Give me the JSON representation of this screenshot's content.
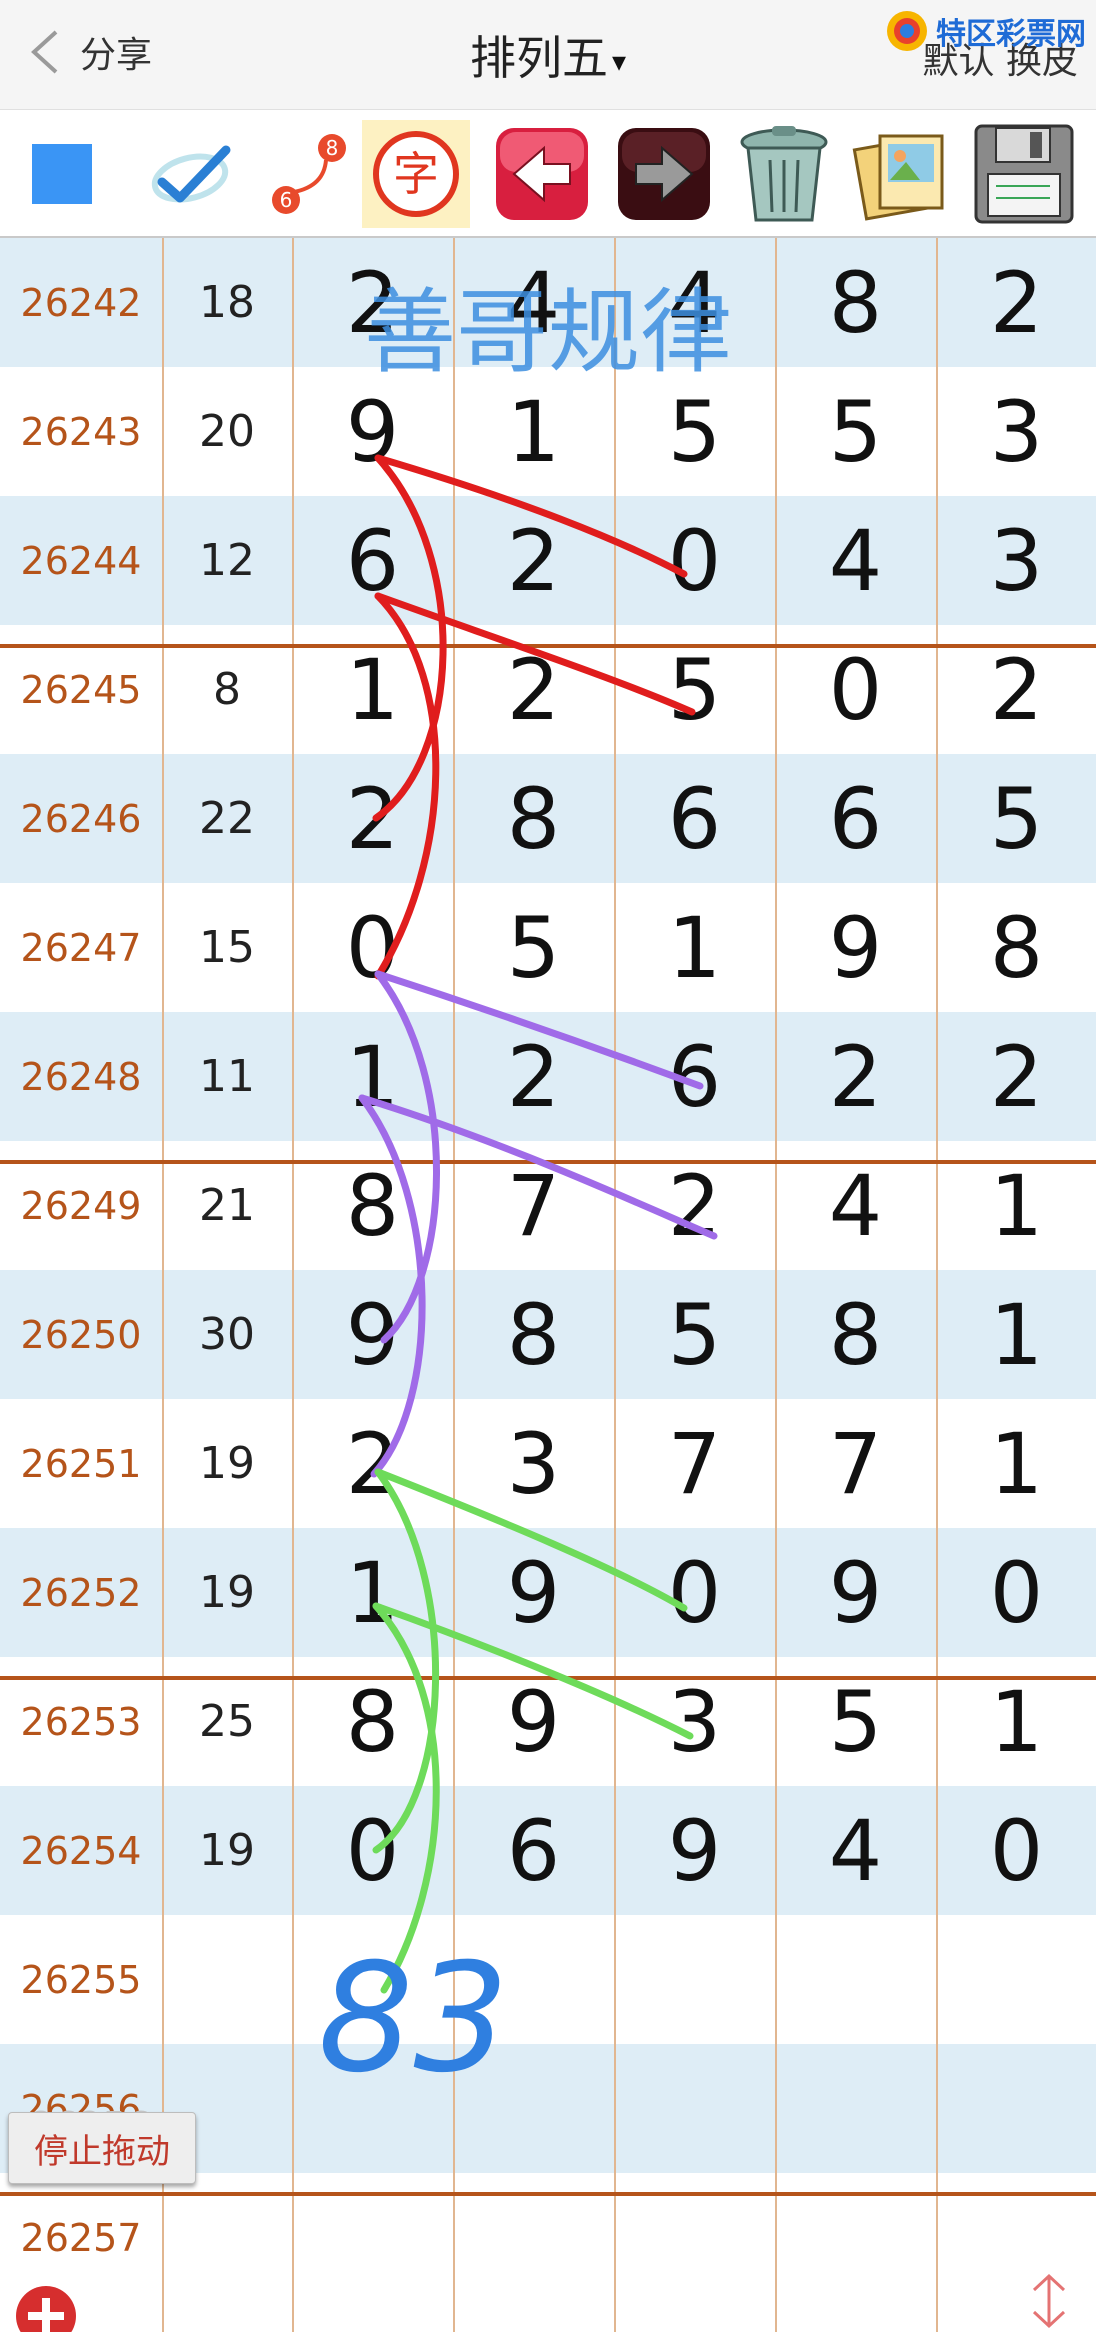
{
  "header": {
    "back_label": "分享",
    "title": "排列五",
    "title_caret": "▾",
    "right_label": "默认 换皮",
    "brand_text": "特区彩票网"
  },
  "toolbar": {
    "items": [
      {
        "name": "color-square-icon"
      },
      {
        "name": "check-pen-icon"
      },
      {
        "name": "connect-icon",
        "badge_top": "8",
        "badge_bottom": "6"
      },
      {
        "name": "text-icon",
        "glyph": "字"
      },
      {
        "name": "back-arrow-icon"
      },
      {
        "name": "forward-arrow-icon"
      },
      {
        "name": "trash-icon"
      },
      {
        "name": "photos-icon"
      },
      {
        "name": "save-disk-icon"
      }
    ]
  },
  "watermark": "善哥规律",
  "rows": [
    {
      "id": "26242",
      "sum": "18",
      "d": [
        "2",
        "4",
        "4",
        "8",
        "2"
      ]
    },
    {
      "id": "26243",
      "sum": "20",
      "d": [
        "9",
        "1",
        "5",
        "5",
        "3"
      ]
    },
    {
      "id": "26244",
      "sum": "12",
      "d": [
        "6",
        "2",
        "0",
        "4",
        "3"
      ]
    },
    {
      "id": "26245",
      "sum": "8",
      "d": [
        "1",
        "2",
        "5",
        "0",
        "2"
      ]
    },
    {
      "id": "26246",
      "sum": "22",
      "d": [
        "2",
        "8",
        "6",
        "6",
        "5"
      ]
    },
    {
      "id": "26247",
      "sum": "15",
      "d": [
        "0",
        "5",
        "1",
        "9",
        "8"
      ]
    },
    {
      "id": "26248",
      "sum": "11",
      "d": [
        "1",
        "2",
        "6",
        "2",
        "2"
      ]
    },
    {
      "id": "26249",
      "sum": "21",
      "d": [
        "8",
        "7",
        "2",
        "4",
        "1"
      ]
    },
    {
      "id": "26250",
      "sum": "30",
      "d": [
        "9",
        "8",
        "5",
        "8",
        "1"
      ]
    },
    {
      "id": "26251",
      "sum": "19",
      "d": [
        "2",
        "3",
        "7",
        "7",
        "1"
      ]
    },
    {
      "id": "26252",
      "sum": "19",
      "d": [
        "1",
        "9",
        "0",
        "9",
        "0"
      ]
    },
    {
      "id": "26253",
      "sum": "25",
      "d": [
        "8",
        "9",
        "3",
        "5",
        "1"
      ]
    },
    {
      "id": "26254",
      "sum": "19",
      "d": [
        "0",
        "6",
        "9",
        "4",
        "0"
      ]
    },
    {
      "id": "26255",
      "sum": "",
      "d": [
        "",
        "",
        "",
        "",
        ""
      ]
    },
    {
      "id": "26256",
      "sum": "",
      "d": [
        "",
        "",
        "",
        "",
        ""
      ]
    },
    {
      "id": "26257",
      "sum": "",
      "d": [
        "",
        "",
        "",
        "",
        ""
      ]
    }
  ],
  "handwriting": "83",
  "stop_drag_label": "停止拖动",
  "colors": {
    "id_text": "#b5541a",
    "row_alt": "#deedf6",
    "red_line": "#e01d1d",
    "purple_line": "#a06be8",
    "green_line": "#6edb5a",
    "blue_ink": "#2f7fe0"
  }
}
